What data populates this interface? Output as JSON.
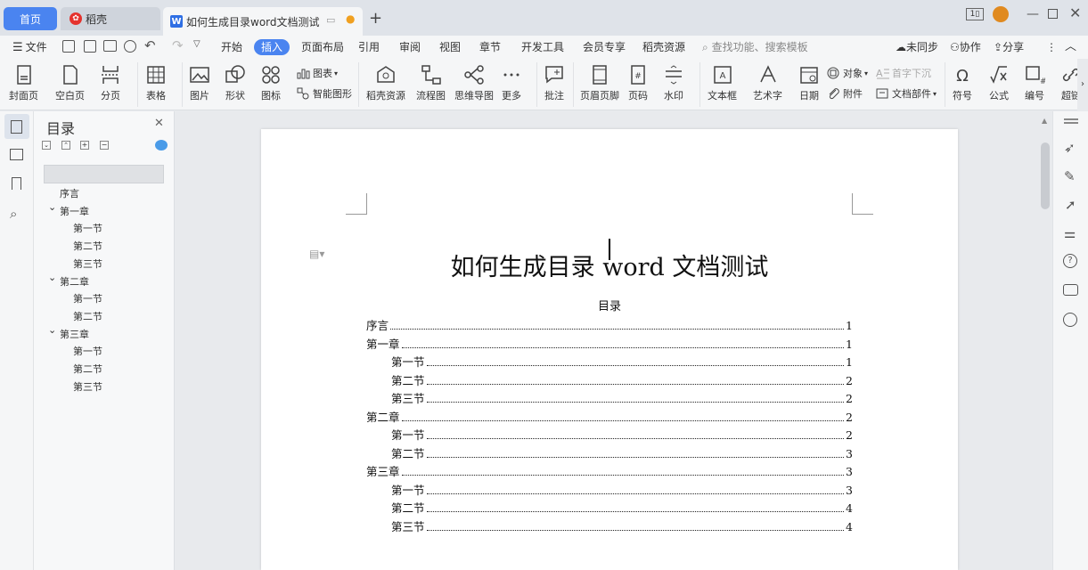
{
  "tabs": {
    "home": "首页",
    "daoke": "稻壳",
    "doc": "如何生成目录word文档测试",
    "doc_icon": "W"
  },
  "menu": {
    "file": "文件",
    "items": [
      "开始",
      "插入",
      "页面布局",
      "引用",
      "审阅",
      "视图",
      "章节",
      "开发工具",
      "会员专享",
      "稻壳资源"
    ],
    "search": "查找功能、搜索模板",
    "sync": "未同步",
    "collab": "协作",
    "share": "分享"
  },
  "ribbon": {
    "cover": "封面页",
    "blank": "空白页",
    "pagebreak": "分页",
    "table": "表格",
    "picture": "图片",
    "shape": "形状",
    "icon": "图标",
    "chart": "图表",
    "smartart": "智能图形",
    "daoke_res": "稻壳资源",
    "flowchart": "流程图",
    "mindmap": "思维导图",
    "more": "更多",
    "comment": "批注",
    "headerfooter": "页眉页脚",
    "pagenum": "页码",
    "watermark": "水印",
    "textbox": "文本框",
    "wordart": "艺术字",
    "date": "日期",
    "object": "对象",
    "attachment": "附件",
    "dropcap": "首字下沉",
    "docpart": "文档部件",
    "symbol": "符号",
    "formula": "公式",
    "numbering": "编号",
    "hyperlink": "超链"
  },
  "nav": {
    "title": "目录",
    "items": [
      {
        "label": "序言",
        "level": 0
      },
      {
        "label": "第一章",
        "level": 1
      },
      {
        "label": "第一节",
        "level": 2
      },
      {
        "label": "第二节",
        "level": 2
      },
      {
        "label": "第三节",
        "level": 2
      },
      {
        "label": "第二章",
        "level": 1
      },
      {
        "label": "第一节",
        "level": 2
      },
      {
        "label": "第二节",
        "level": 2
      },
      {
        "label": "第三章",
        "level": 1
      },
      {
        "label": "第一节",
        "level": 2
      },
      {
        "label": "第二节",
        "level": 2
      },
      {
        "label": "第三节",
        "level": 2
      }
    ]
  },
  "document": {
    "title": "如何生成目录 word 文档测试",
    "toc_heading": "目录",
    "toc": [
      {
        "label": "序言",
        "page": "1",
        "indent": 0
      },
      {
        "label": "第一章",
        "page": "1",
        "indent": 0
      },
      {
        "label": "第一节",
        "page": "1",
        "indent": 1
      },
      {
        "label": "第二节",
        "page": "2",
        "indent": 1
      },
      {
        "label": "第三节",
        "page": "2",
        "indent": 1
      },
      {
        "label": "第二章",
        "page": "2",
        "indent": 0
      },
      {
        "label": "第一节",
        "page": "2",
        "indent": 1
      },
      {
        "label": "第二节",
        "page": "3",
        "indent": 1
      },
      {
        "label": "第三章",
        "page": "3",
        "indent": 0
      },
      {
        "label": "第一节",
        "page": "3",
        "indent": 1
      },
      {
        "label": "第二节",
        "page": "4",
        "indent": 1
      },
      {
        "label": "第三节",
        "page": "4",
        "indent": 1
      }
    ]
  },
  "colors": {
    "accent": "#4a84f0",
    "tab_bg": "#dfe3e9",
    "ribbon_bg": "#f5f6f7"
  }
}
